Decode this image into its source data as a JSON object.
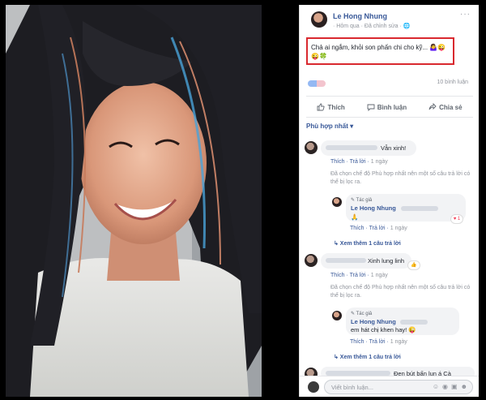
{
  "post": {
    "author": "Le Hong Nhung",
    "meta": "· Hôm qua · Đã chỉnh sửa · 🌐",
    "text": "Chả ai ngắm, khỏi son phấn chi cho kỹ... 🤷‍♀️😜😜🍀",
    "comments_count": "10 bình luận",
    "more_icon": "···"
  },
  "actions": {
    "like": "Thích",
    "comment": "Bình luận",
    "share": "Chia sẻ"
  },
  "sort_label": "Phù hợp nhất ▾",
  "comments": [
    {
      "text": "Vẫn xinh!",
      "like": "Thích",
      "reply": "Trả lời",
      "time": "1 ngày",
      "notice": "Đã chọn chế độ Phù hợp nhất nên một số câu trả lời có thể bị lọc ra.",
      "reply_item": {
        "author_tag": "✎ Tác giả",
        "name": "Le Hong Nhung",
        "text": "🙏",
        "like": "Thích",
        "reply": "Trả lời",
        "time": "1 ngày",
        "reaction": "♥ 1"
      },
      "see_more": "↳ Xem thêm 1 câu trả lời"
    },
    {
      "text": "Xinh lung linh",
      "like": "Thích",
      "reply": "Trả lời",
      "time": "1 ngày",
      "notice": "Đã chọn chế độ Phù hợp nhất nên một số câu trả lời có thể bị lọc ra.",
      "reply_item": {
        "author_tag": "✎ Tác giả",
        "name": "Le Hong Nhung",
        "text": "em hát chị khen hay! 😜",
        "like": "Thích",
        "reply": "Trả lời",
        "time": "1 ngày",
        "reaction": "👍 1"
      },
      "see_more": "↳ Xem thêm 1 câu trả lời"
    }
  ],
  "partial_comment": "Đen bút bấn lun á Cà",
  "comment_input": {
    "placeholder": "Viết bình luận..."
  },
  "colors": {
    "brand": "#385898",
    "highlight_border": "#d9292f"
  }
}
